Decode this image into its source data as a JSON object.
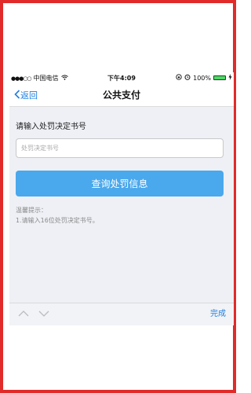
{
  "status_bar": {
    "carrier": "中国电信",
    "time": "下午4:09",
    "battery_percent": "100%",
    "battery_level": 1.0,
    "icons": [
      "signal-icon",
      "wifi-icon",
      "lock-rotation-icon",
      "alarm-icon",
      "battery-icon",
      "charging-icon"
    ]
  },
  "nav": {
    "back_label": "返回",
    "title": "公共支付"
  },
  "form": {
    "prompt": "请输入处罚决定书号",
    "input_value": "",
    "input_placeholder": "处罚决定书号",
    "query_button": "查询处罚信息"
  },
  "tips": {
    "title": "温馨提示：",
    "item1": "1.请输入16位处罚决定书号。"
  },
  "keyboard_toolbar": {
    "done_label": "完成"
  },
  "colors": {
    "frame_border": "#e12a2a",
    "accent": "#1f7fe0",
    "button_bg": "#4aa8ec",
    "page_bg": "#eef0f5",
    "battery_fill": "#4cd964"
  }
}
